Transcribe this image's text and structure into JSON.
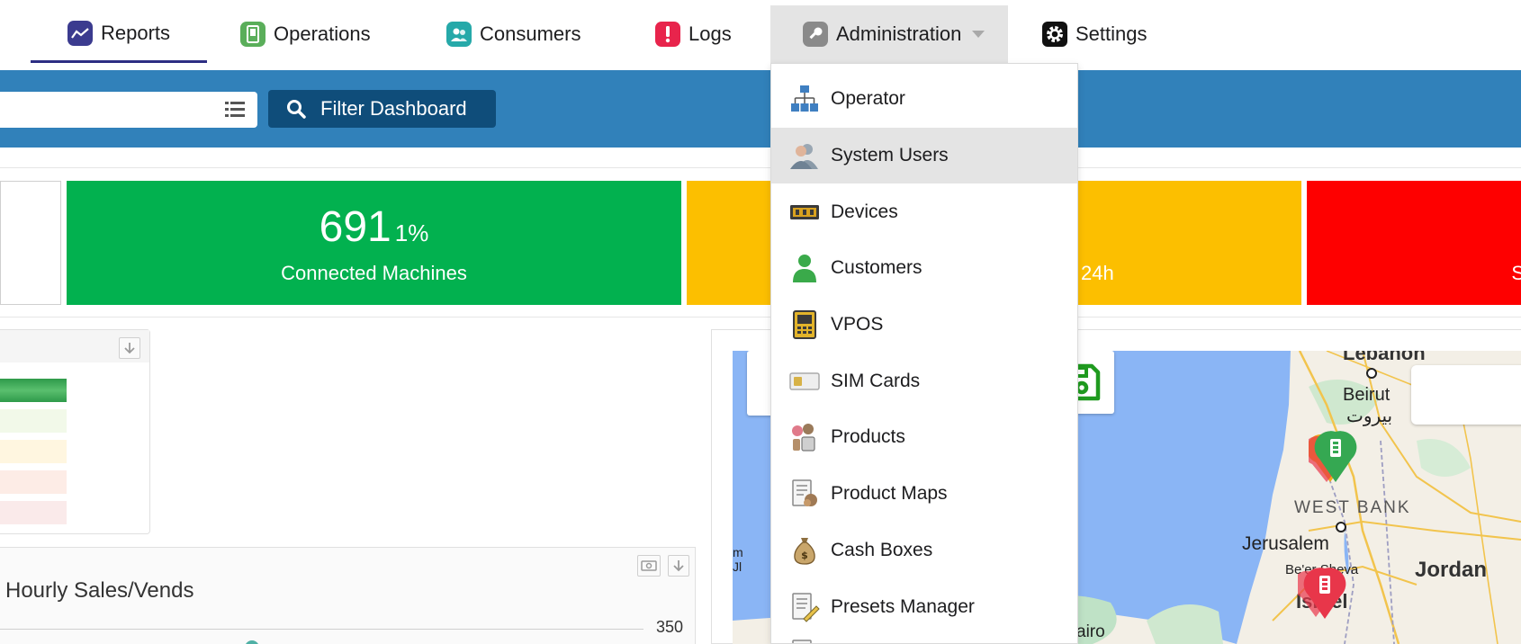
{
  "nav": {
    "items": [
      {
        "label": "Reports",
        "icon": "chart-line-icon",
        "color": "#3b3b8f",
        "active": true
      },
      {
        "label": "Operations",
        "icon": "vending-machine-icon",
        "color": "#5aae5a"
      },
      {
        "label": "Consumers",
        "icon": "users-icon",
        "color": "#26a9a9"
      },
      {
        "label": "Logs",
        "icon": "alert-icon",
        "color": "#e8244c"
      },
      {
        "label": "Administration",
        "icon": "key-icon",
        "color": "#8a8a8a",
        "open": true
      },
      {
        "label": "Settings",
        "icon": "gear-icon",
        "color": "#111111"
      }
    ]
  },
  "toolbar": {
    "search_value": "",
    "filter_label": "Filter Dashboard"
  },
  "kpis": {
    "connected": {
      "value": "691",
      "percent": "1%",
      "label": "Connected Machines",
      "color": "#02b14f"
    },
    "yellow": {
      "label": "24h",
      "color": "#fcbf00"
    },
    "red": {
      "label": "S",
      "color": "#fe0000"
    }
  },
  "hourly_chart": {
    "title": "Hourly Sales/Vends",
    "tick": "350"
  },
  "map": {
    "labels": {
      "lebanon": "Lebanon",
      "beirut": "Beirut",
      "beirut_ar": "بيروت",
      "west_bank": "WEST BANK",
      "jerusalem": "Jerusalem",
      "beer_sheva": "Be'er Sheva",
      "jordan": "Jordan",
      "israel": "Israel",
      "cairo": "airo",
      "edge1": "m",
      "edge2": "Jl"
    }
  },
  "admin_menu": {
    "items": [
      {
        "label": "Operator",
        "icon": "org-chart-icon"
      },
      {
        "label": "System Users",
        "icon": "user-icon",
        "hover": true
      },
      {
        "label": "Devices",
        "icon": "device-icon"
      },
      {
        "label": "Customers",
        "icon": "customer-icon"
      },
      {
        "label": "VPOS",
        "icon": "pos-icon"
      },
      {
        "label": "SIM Cards",
        "icon": "sim-card-icon"
      },
      {
        "label": "Products",
        "icon": "products-icon"
      },
      {
        "label": "Product Maps",
        "icon": "product-map-icon"
      },
      {
        "label": "Cash Boxes",
        "icon": "money-bag-icon"
      },
      {
        "label": "Presets Manager",
        "icon": "preset-icon"
      }
    ]
  }
}
